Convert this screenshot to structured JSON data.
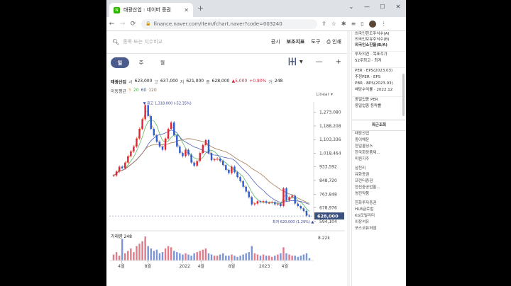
{
  "browser": {
    "tab_title": "태광산업 : 네이버 증권",
    "favicon_letter": "N",
    "url": "finance.naver.com/item/fchart.naver?code=003240"
  },
  "header": {
    "search_placeholder": "종목 또는 지수비교",
    "menu": [
      "공시",
      "보조지표",
      "도구",
      "인쇄"
    ]
  },
  "period_tabs": [
    "일",
    "주",
    "월"
  ],
  "quote": {
    "name": "태광산업",
    "open_label": "시",
    "open": "623,000",
    "high_label": "고",
    "high": "637,000",
    "low_label": "저",
    "low": "621,000",
    "close_label": "종",
    "close": "628,000",
    "change": "▲5,000",
    "change_pct": "+0.80%",
    "vol_label": "거",
    "volume": "248"
  },
  "moving_avg": {
    "label": "이동평균",
    "periods": [
      "5",
      "20",
      "60",
      "120"
    ]
  },
  "scale_label": "Linear",
  "sidebar": {
    "top_items": [
      "외국인한도주식수(A)",
      "외국인보유주식수(B)",
      "외국인소진율(B/A)"
    ],
    "invest": [
      "투자의견 · 목표주가",
      "52주최고 · 최저"
    ],
    "ratios": [
      "PER · EPS(2023.03)",
      "추정PER · EPS",
      "PBR · BPS(2023.03)",
      "배당수익률 · 2022.12"
    ],
    "industry": [
      "동일업종 PER",
      "동일업종 등락률"
    ],
    "recent_title": "최근조회",
    "recent": [
      "태광산업",
      "종이해운",
      "한일홀딩스",
      "한국화장품제...",
      "미원지주",
      "삼천리",
      "유화증권",
      "프린터증권",
      "한진중공업홀...",
      "영진약품",
      "한화투자증권",
      "HLB글로벌",
      "KG모빌리티",
      "이장석유",
      "포스코퓨처엠"
    ]
  },
  "chart_data": {
    "type": "line",
    "title": "",
    "ylim": [
      580000,
      1320000
    ],
    "y_ticks": [
      "1,273,080",
      "1,188,208",
      "1,103,336",
      "1,018,464",
      "933,592",
      "848,720",
      "763,848",
      "678,976",
      "594,104"
    ],
    "y_tick_values": [
      1273080,
      1188208,
      1103336,
      1018464,
      933592,
      848720,
      763848,
      678976,
      594104
    ],
    "x_ticks": [
      "4월",
      "8월",
      "2022",
      "4월",
      "8월",
      "2023",
      "4월"
    ],
    "max_label": "최고 1,318,000 (-52.35%)",
    "min_label": "최저 620,000 (1.29%)",
    "last_price_label": "628,000",
    "last_price": 628000,
    "volume_label": "거래량 248",
    "volume_tick": "8.22k",
    "colors": {
      "price": "#d9534f",
      "ma5": "#e6a23c",
      "ma20": "#4caf50",
      "ma60": "#3f51b5",
      "ma120": "#9c6b3f"
    },
    "series": [
      {
        "values": [
          880000,
          905000,
          935000,
          925000,
          960000,
          1000000,
          1030000,
          1060000,
          1110000,
          1170000,
          1230000,
          1318000,
          1250000,
          1170000,
          1130000,
          1090000,
          1060000,
          1040000,
          1110000,
          1170000,
          1210000,
          1130000,
          1060000,
          1020000,
          1000000,
          1040000,
          1010000,
          960000,
          940000,
          970000,
          1020000,
          1070000,
          1100000,
          1020000,
          975000,
          980000,
          985000,
          970000,
          945000,
          915000,
          895000,
          935000,
          900000,
          870000,
          845000,
          810000,
          780000,
          745000,
          700000,
          705000,
          720000,
          715000,
          720000,
          710000,
          710000,
          715000,
          700000,
          705000,
          690000,
          800000,
          725000,
          745000,
          755000,
          705000,
          690000,
          675000,
          660000,
          630000,
          628000
        ]
      }
    ],
    "volume": [
      0.25,
      0.35,
      0.2,
      0.9,
      0.3,
      0.4,
      0.5,
      0.35,
      0.6,
      0.7,
      0.8,
      1.0,
      0.6,
      0.5,
      0.4,
      0.45,
      0.3,
      0.35,
      0.5,
      0.6,
      0.55,
      0.4,
      0.35,
      0.3,
      0.25,
      0.3,
      0.25,
      0.2,
      0.3,
      0.35,
      0.4,
      0.45,
      0.5,
      0.3,
      0.25,
      0.2,
      0.2,
      0.25,
      0.3,
      0.2,
      0.2,
      0.25,
      0.2,
      0.15,
      0.2,
      0.25,
      0.3,
      0.35,
      0.6,
      0.3,
      0.25,
      0.2,
      0.25,
      0.2,
      0.2,
      0.15,
      0.2,
      0.25,
      0.3,
      0.55,
      0.3,
      0.25,
      0.2,
      0.2,
      0.15,
      0.2,
      0.25,
      0.3,
      0.1
    ]
  }
}
